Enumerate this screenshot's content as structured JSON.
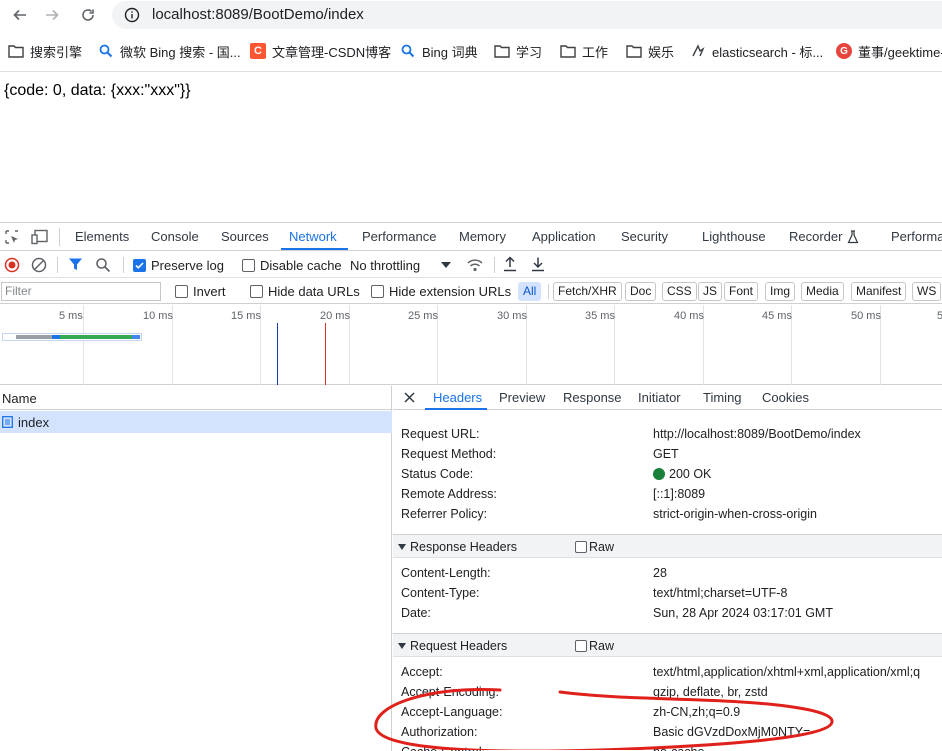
{
  "browser": {
    "url": "localhost:8089/BootDemo/index",
    "bookmarks": [
      {
        "label": "搜索引擎",
        "icon": "folder-icon"
      },
      {
        "label": "微软 Bing 搜索 - 国...",
        "icon": "bing-search-icon"
      },
      {
        "label": "文章管理-CSDN博客",
        "icon": "csdn-icon"
      },
      {
        "label": "Bing 词典",
        "icon": "bing-search-icon"
      },
      {
        "label": "学习",
        "icon": "folder-icon"
      },
      {
        "label": "工作",
        "icon": "folder-icon"
      },
      {
        "label": "娱乐",
        "icon": "folder-icon"
      },
      {
        "label": "elasticsearch - 标...",
        "icon": "elastic-icon"
      },
      {
        "label": "董事/geektime-",
        "icon": "geektime-icon"
      }
    ]
  },
  "page": {
    "body_text": "{code: 0, data: {xxx:\"xxx\"}}"
  },
  "devtools": {
    "tabs": [
      "Elements",
      "Console",
      "Sources",
      "Network",
      "Performance",
      "Memory",
      "Application",
      "Security",
      "Lighthouse",
      "Recorder",
      "Performa"
    ],
    "active_tab": "Network",
    "toolbar": {
      "preserve_log": "Preserve log",
      "disable_cache": "Disable cache",
      "throttling": "No throttling"
    },
    "filter": {
      "placeholder": "Filter",
      "invert": "Invert",
      "hide_data_urls": "Hide data URLs",
      "hide_extension_urls": "Hide extension URLs",
      "chips": [
        "All",
        "Fetch/XHR",
        "Doc",
        "CSS",
        "JS",
        "Font",
        "Img",
        "Media",
        "Manifest",
        "WS"
      ],
      "active_chip": "All"
    },
    "overview_ticks": [
      "5 ms",
      "10 ms",
      "15 ms",
      "20 ms",
      "25 ms",
      "30 ms",
      "35 ms",
      "40 ms",
      "45 ms",
      "50 ms",
      "5"
    ],
    "request_list": {
      "header": "Name",
      "rows": [
        "index"
      ]
    },
    "details": {
      "tabs": [
        "Headers",
        "Preview",
        "Response",
        "Initiator",
        "Timing",
        "Cookies"
      ],
      "active_tab": "Headers",
      "general": [
        {
          "key": "Request URL:",
          "value": "http://localhost:8089/BootDemo/index"
        },
        {
          "key": "Request Method:",
          "value": "GET"
        },
        {
          "key": "Status Code:",
          "value": "200 OK"
        },
        {
          "key": "Remote Address:",
          "value": "[::1]:8089"
        },
        {
          "key": "Referrer Policy:",
          "value": "strict-origin-when-cross-origin"
        }
      ],
      "response_headers_title": "Response Headers",
      "response_headers": [
        {
          "key": "Content-Length:",
          "value": "28"
        },
        {
          "key": "Content-Type:",
          "value": "text/html;charset=UTF-8"
        },
        {
          "key": "Date:",
          "value": "Sun, 28 Apr 2024 03:17:01 GMT"
        }
      ],
      "request_headers_title": "Request Headers",
      "raw_label": "Raw",
      "request_headers": [
        {
          "key": "Accept:",
          "value": "text/html,application/xhtml+xml,application/xml;q"
        },
        {
          "key": "Accept-Encoding:",
          "value": "gzip, deflate, br, zstd"
        },
        {
          "key": "Accept-Language:",
          "value": "zh-CN,zh;q=0.9"
        },
        {
          "key": "Authorization:",
          "value": "Basic dGVzdDoxMjM0NTY="
        },
        {
          "key": "Cache-Control:",
          "value": "no-cache"
        }
      ]
    },
    "colors": {
      "accent": "#1a73e8",
      "record": "#d93025",
      "status_ok": "#188038",
      "annotation": "#e0201b"
    }
  }
}
